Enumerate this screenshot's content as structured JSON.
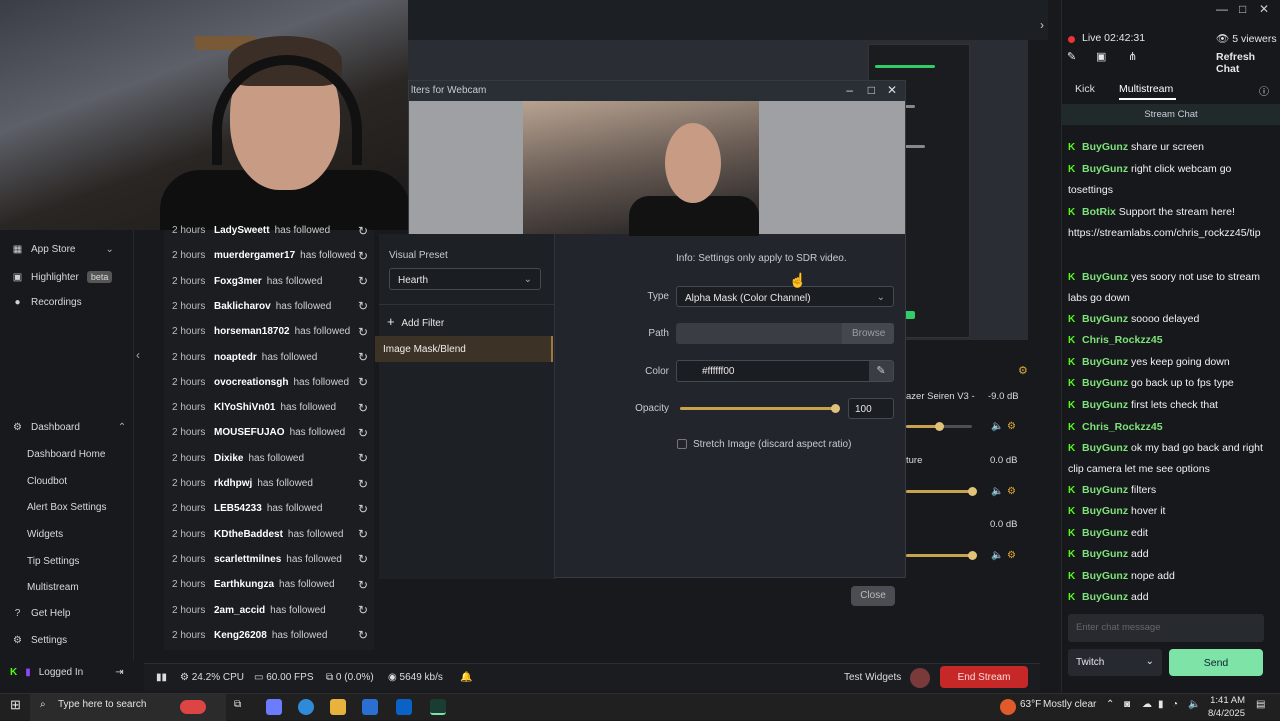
{
  "webcam_filter_dialog": {
    "title": "lters for Webcam",
    "visual_preset_label": "Visual Preset",
    "visual_preset_value": "Hearth",
    "add_filter_label": "Add Filter",
    "selected_filter": "Image Mask/Blend",
    "info_text": "Info: Settings only apply to SDR video.",
    "type_label": "Type",
    "type_value": "Alpha Mask (Color Channel)",
    "path_label": "Path",
    "browse_label": "Browse",
    "color_label": "Color",
    "color_value": "#ffffff00",
    "opacity_label": "Opacity",
    "opacity_value": "100",
    "opacity_fraction": 1.0,
    "stretch_label": "Stretch Image (discard aspect ratio)",
    "close_label": "Close"
  },
  "sidenav": {
    "app_store": "App Store",
    "highlighter": "Highlighter",
    "highlighter_badge": "beta",
    "recordings": "Recordings",
    "dashboard": "Dashboard",
    "dashboard_home": "Dashboard Home",
    "cloudbot": "Cloudbot",
    "alert_box": "Alert Box Settings",
    "widgets": "Widgets",
    "tip_settings": "Tip Settings",
    "multistream": "Multistream",
    "get_help": "Get Help",
    "settings": "Settings",
    "logged_in": "Logged In"
  },
  "followers": [
    {
      "time": "2 hours",
      "name": "LadySweett",
      "msg": "has followed"
    },
    {
      "time": "2 hours",
      "name": "muerdergamer17",
      "msg": "has followed"
    },
    {
      "time": "2 hours",
      "name": "Foxg3mer",
      "msg": "has followed"
    },
    {
      "time": "2 hours",
      "name": "Baklicharov",
      "msg": "has followed"
    },
    {
      "time": "2 hours",
      "name": "horseman18702",
      "msg": "has followed"
    },
    {
      "time": "2 hours",
      "name": "noaptedr",
      "msg": "has followed"
    },
    {
      "time": "2 hours",
      "name": "ovocreationsgh",
      "msg": "has followed"
    },
    {
      "time": "2 hours",
      "name": "KlYoShiVn01",
      "msg": "has followed"
    },
    {
      "time": "2 hours",
      "name": "MOUSEFUJAO",
      "msg": "has followed"
    },
    {
      "time": "2 hours",
      "name": "Dixike",
      "msg": "has followed"
    },
    {
      "time": "2 hours",
      "name": "rkdhpwj",
      "msg": "has followed"
    },
    {
      "time": "2 hours",
      "name": "LEB54233",
      "msg": "has followed"
    },
    {
      "time": "2 hours",
      "name": "KDtheBaddest",
      "msg": "has followed"
    },
    {
      "time": "2 hours",
      "name": "scarlettmilnes",
      "msg": "has followed"
    },
    {
      "time": "2 hours",
      "name": "Earthkungza",
      "msg": "has followed"
    },
    {
      "time": "2 hours",
      "name": "2am_accid",
      "msg": "has followed"
    },
    {
      "time": "2 hours",
      "name": "Keng26208",
      "msg": "has followed"
    }
  ],
  "mixer": {
    "source1": "azer Seiren V3 -",
    "source1_db": "-9.0 dB",
    "source2": "ture",
    "source2_db": "0.0 dB",
    "source3_db": "0.0 dB"
  },
  "status_bar": {
    "cpu": "24.2% CPU",
    "fps": "60.00 FPS",
    "dropped": "0 (0.0%)",
    "bitrate": "5649 kb/s",
    "test_widgets": "Test Widgets",
    "end_stream": "End Stream"
  },
  "chat": {
    "live_label": "Live 02:42:31",
    "viewers": "5 viewers",
    "refresh": "Refresh Chat",
    "tab_kick": "Kick",
    "tab_multistream": "Multistream",
    "stream_chat": "Stream Chat",
    "input_placeholder": "Enter chat message",
    "platform": "Twitch",
    "send": "Send",
    "messages": [
      {
        "user": "BuyGunz",
        "text": "share ur screen"
      },
      {
        "user": "BuyGunz",
        "text": "right click webcam go tosettings"
      },
      {
        "user": "BotRix",
        "text": "Support the stream here! https://streamlabs.com/chris_rockzz45/tip"
      },
      {
        "user": "BuyGunz",
        "text": "yes soory not use to stream labs go down"
      },
      {
        "user": "BuyGunz",
        "text": "soooo delayed"
      },
      {
        "user": "Chris_Rockzz45",
        "text": ""
      },
      {
        "user": "BuyGunz",
        "text": "yes keep going down"
      },
      {
        "user": "BuyGunz",
        "text": "go back up to fps type"
      },
      {
        "user": "BuyGunz",
        "text": "first lets check that"
      },
      {
        "user": "Chris_Rockzz45",
        "text": ""
      },
      {
        "user": "BuyGunz",
        "text": "ok my bad go back and right clip camera let me see options"
      },
      {
        "user": "BuyGunz",
        "text": "filters"
      },
      {
        "user": "BuyGunz",
        "text": "hover it"
      },
      {
        "user": "BuyGunz",
        "text": "edit"
      },
      {
        "user": "BuyGunz",
        "text": "add"
      },
      {
        "user": "BuyGunz",
        "text": "nope add"
      },
      {
        "user": "BuyGunz",
        "text": "add"
      }
    ]
  },
  "taskbar": {
    "search_placeholder": "Type here to search",
    "weather_temp": "63°F",
    "weather_desc": "Mostly clear",
    "time": "1:41 AM",
    "date": "8/4/2025"
  },
  "colors": {
    "accent_kick": "#53fc18",
    "end_stream": "#c62828",
    "send": "#7de3a6",
    "filter_selected": "#3c3326"
  }
}
